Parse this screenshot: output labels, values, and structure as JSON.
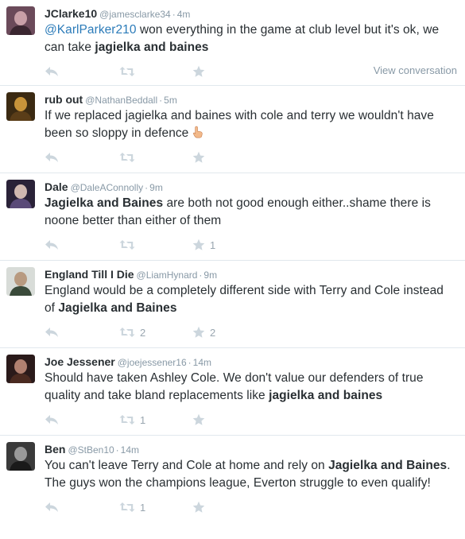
{
  "tweets": [
    {
      "name": "JClarke10",
      "handle": "@jamesclarke34",
      "time": "4m",
      "text": [
        {
          "t": "@KarlParker210",
          "style": "mention"
        },
        {
          "t": " won everything in the game at club level but it's ok, we can take ",
          "style": "normal"
        },
        {
          "t": "jagielka and baines",
          "style": "bold"
        }
      ],
      "retweets": "",
      "favorites": "",
      "view_conversation": "View conversation",
      "avatar_colors": [
        "#6b4a5a",
        "#c9a0a8",
        "#3a2630"
      ]
    },
    {
      "name": "rub out",
      "handle": "@NathanBeddall",
      "time": "5m",
      "text": [
        {
          "t": "If we replaced jagielka and baines with cole and terry we wouldn't have been so sloppy in defence ",
          "style": "normal"
        }
      ],
      "emoji": "pointing-hand-icon",
      "retweets": "",
      "favorites": "",
      "avatar_colors": [
        "#3b2a12",
        "#c8943a",
        "#5a3d18"
      ]
    },
    {
      "name": "Dale",
      "handle": "@DaleAConnolly",
      "time": "9m",
      "text": [
        {
          "t": "Jagielka and Baines",
          "style": "bold"
        },
        {
          "t": " are both not good enough either..shame there is noone better than either of them",
          "style": "normal"
        }
      ],
      "retweets": "",
      "favorites": "1",
      "avatar_colors": [
        "#2a2238",
        "#d0b8b0",
        "#5a4a78"
      ]
    },
    {
      "name": "England Till I Die",
      "handle": "@LiamHynard",
      "time": "9m",
      "text": [
        {
          "t": "England would be a completely different side with Terry and Cole instead of ",
          "style": "normal"
        },
        {
          "t": "Jagielka and Baines",
          "style": "bold"
        }
      ],
      "retweets": "2",
      "favorites": "2",
      "avatar_colors": [
        "#d8dcd8",
        "#b89a80",
        "#3a4a3a"
      ]
    },
    {
      "name": "Joe Jessener",
      "handle": "@joejessener16",
      "time": "14m",
      "text": [
        {
          "t": "Should have taken Ashley Cole. We don't value our defenders of true quality and take bland replacements like ",
          "style": "normal"
        },
        {
          "t": "jagielka and baines",
          "style": "bold"
        }
      ],
      "retweets": "1",
      "favorites": "",
      "avatar_colors": [
        "#2a1a1a",
        "#b08070",
        "#4a2a20"
      ]
    },
    {
      "name": "Ben",
      "handle": "@StBen10",
      "time": "14m",
      "text": [
        {
          "t": "You can't leave Terry and Cole at home and rely on ",
          "style": "normal"
        },
        {
          "t": "Jagielka and Baines",
          "style": "bold"
        },
        {
          "t": ". The guys won the champions league, Everton struggle to even qualify!",
          "style": "normal"
        }
      ],
      "retweets": "1",
      "favorites": "",
      "avatar_colors": [
        "#3a3a3a",
        "#9a9a9a",
        "#1a1a1a"
      ]
    }
  ],
  "icons": {
    "reply": "reply-icon",
    "retweet": "retweet-icon",
    "favorite": "star-icon"
  },
  "colors": {
    "text": "#292f33",
    "muted": "#8899a6",
    "link": "#2b7bb9",
    "action": "#ccd6dd",
    "divider": "#e1e8ed"
  }
}
